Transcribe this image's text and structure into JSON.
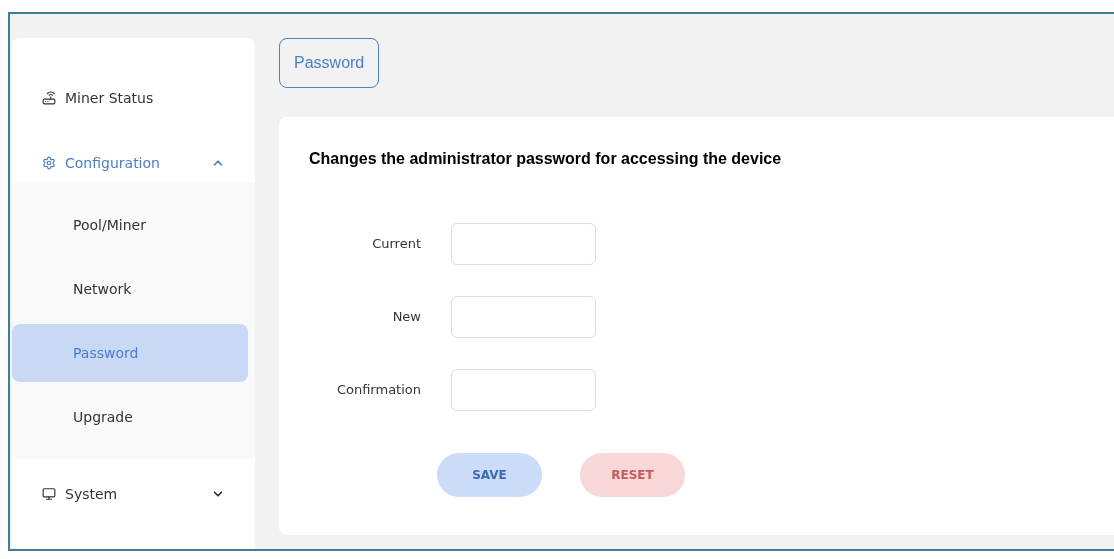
{
  "sidebar": {
    "items": [
      {
        "kind": "item",
        "label": "Miner Status",
        "selected": false
      },
      {
        "kind": "group",
        "label": "Configuration",
        "selected": true,
        "expanded": true,
        "children": [
          {
            "label": "Pool/Miner",
            "selected": false
          },
          {
            "label": "Network",
            "selected": false
          },
          {
            "label": "Password",
            "selected": true
          },
          {
            "label": "Upgrade",
            "selected": false
          }
        ]
      },
      {
        "kind": "group",
        "label": "System",
        "selected": false,
        "expanded": false
      }
    ]
  },
  "tabs": [
    {
      "label": "Password",
      "selected": true
    }
  ],
  "form": {
    "heading": "Changes the administrator password for accessing the device",
    "fields": [
      {
        "label": "Current"
      },
      {
        "label": "New"
      },
      {
        "label": "Confirmation"
      }
    ],
    "buttons": [
      {
        "kind": "primary",
        "label": "SAVE"
      },
      {
        "kind": "danger",
        "label": "RESET"
      }
    ]
  }
}
